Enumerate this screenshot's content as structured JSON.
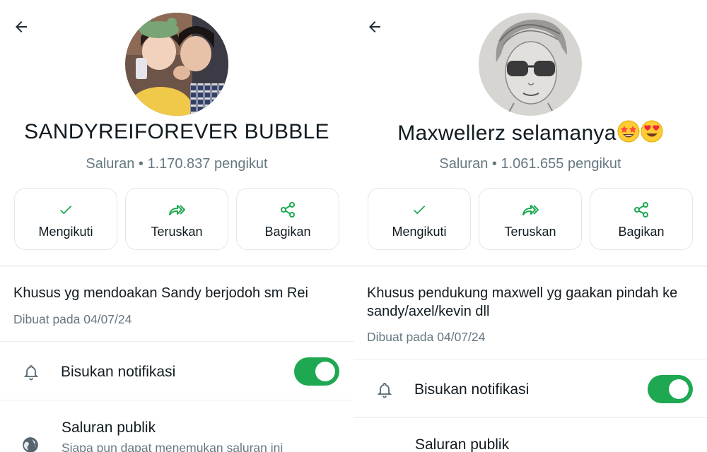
{
  "left": {
    "title": "SANDYREIFOREVER BUBBLE",
    "subtitle": "Saluran • 1.170.837 pengikut",
    "actions": {
      "follow": "Mengikuti",
      "forward": "Teruskan",
      "share": "Bagikan"
    },
    "description": "Khusus yg mendoakan Sandy berjodoh sm Rei",
    "created": "Dibuat pada 04/07/24",
    "mute_label": "Bisukan notifikasi",
    "mute_on": true,
    "public_label": "Saluran publik",
    "public_desc": "Siapa pun dapat menemukan saluran ini"
  },
  "right": {
    "title": "Maxwellerz selamanya",
    "title_emojis": [
      "star-struck-emoji",
      "heart-eyes-emoji"
    ],
    "subtitle": "Saluran • 1.061.655 pengikut",
    "actions": {
      "follow": "Mengikuti",
      "forward": "Teruskan",
      "share": "Bagikan"
    },
    "description": "Khusus pendukung maxwell yg gaakan pindah ke sandy/axel/kevin dll",
    "created": "Dibuat pada 04/07/24",
    "mute_label": "Bisukan notifikasi",
    "mute_on": true,
    "public_label": "Saluran publik"
  },
  "colors": {
    "accent": "#1da851",
    "muted_text": "#667781",
    "text": "#111b21"
  }
}
